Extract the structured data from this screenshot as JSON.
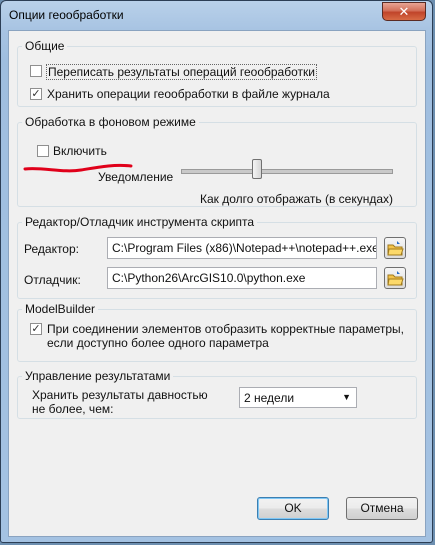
{
  "window": {
    "title": "Опции геообработки",
    "close": "✕"
  },
  "general": {
    "legend": "Общие",
    "overwrite_label": "Переписать результаты операций геообработки",
    "overwrite_checked": false,
    "log_label": "Хранить операции геообработки в файле журнала",
    "log_checked": true
  },
  "background": {
    "legend": "Обработка в фоновом режиме",
    "enable_label": "Включить",
    "enable_checked": false,
    "notify_label": "Уведомление",
    "slider_caption": "Как долго отображать (в секундах)"
  },
  "script_tool": {
    "legend": "Редактор/Отладчик инструмента скрипта",
    "editor_label": "Редактор:",
    "editor_value": "C:\\Program Files (x86)\\Notepad++\\notepad++.exe",
    "debugger_label": "Отладчик:",
    "debugger_value": "C:\\Python26\\ArcGIS10.0\\python.exe"
  },
  "modelbuilder": {
    "legend": "ModelBuilder",
    "connect_label": "При соединении элементов отобразить корректные параметры, если доступно более одного параметра",
    "connect_checked": true
  },
  "results": {
    "legend": "Управление результатами",
    "keep_label": "Хранить результаты давностью не более, чем:",
    "keep_value": "2 недели"
  },
  "buttons": {
    "ok": "OK",
    "cancel": "Отмена"
  },
  "colors": {
    "annotation": "#e0001a",
    "titlebar": "#a9c4e2",
    "client": "#f0f0f0"
  }
}
